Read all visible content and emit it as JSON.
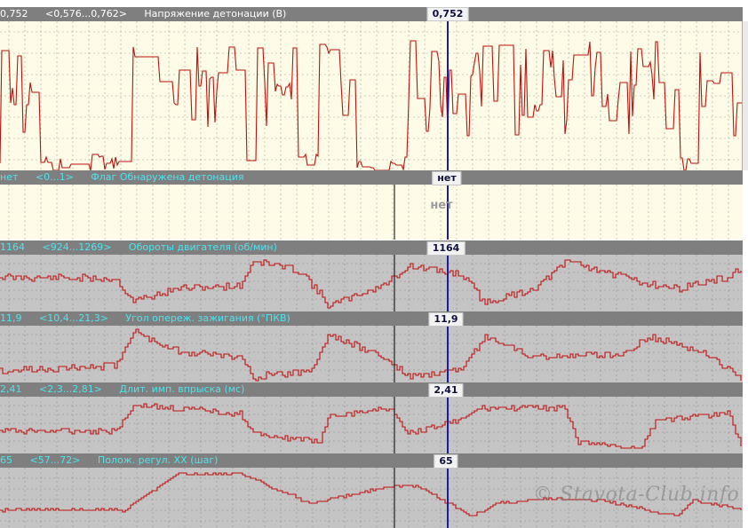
{
  "cursor": {
    "x_label": "",
    "line_color": "#1a1ab0"
  },
  "colors": {
    "trace": "#c01010",
    "plot_light": "#fefce6",
    "plot_gray": "#c4c4c4",
    "header_bg": "#7f7f7f",
    "grid": "#777777"
  },
  "channels": [
    {
      "id": "knock_voltage",
      "value": "0,752",
      "range": "<0,576...0,762>",
      "name": "Напряжение детонации (В)",
      "cursor_value": "0,752",
      "header_color": "white",
      "plot": "light"
    },
    {
      "id": "knock_flag",
      "value": "нет",
      "range": "<0...1>",
      "name": "Флаг Обнаружена детонация",
      "cursor_value": "нет",
      "plot_tag": "нет",
      "header_color": "cyan",
      "plot": "light"
    },
    {
      "id": "rpm",
      "value": "1164",
      "range": "<924...1269>",
      "name": "Обороты двигателя (об/мин)",
      "cursor_value": "1164",
      "header_color": "cyan",
      "plot": "gray"
    },
    {
      "id": "ignition",
      "value": "11,9",
      "range": "<10,4...21,3>",
      "name": "Угол опереж. зажигания (°ПКВ)",
      "cursor_value": "11,9",
      "header_color": "cyan",
      "plot": "gray"
    },
    {
      "id": "injection",
      "value": "2,41",
      "range": "<2,3...2,81>",
      "name": "Длит. имп. впрыска (мс)",
      "cursor_value": "2,41",
      "header_color": "cyan",
      "plot": "gray"
    },
    {
      "id": "iac",
      "value": "65",
      "range": "<57...72>",
      "name": "Полож. регул. ХХ (шаг)",
      "cursor_value": "65",
      "header_color": "cyan",
      "plot": "gray"
    }
  ],
  "watermark": "© Stavota-Club.info"
}
